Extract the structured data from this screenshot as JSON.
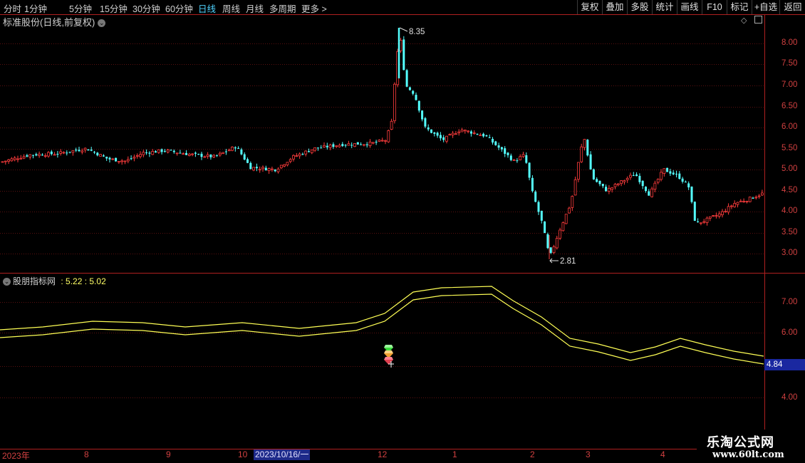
{
  "toolbar": {
    "timeframes": [
      "分时",
      "1分钟",
      "5分钟",
      "15分钟",
      "30分钟",
      "60分钟",
      "日线",
      "周线",
      "月线",
      "多周期",
      "更多 >"
    ],
    "active": "日线",
    "buttons": [
      "复权",
      "叠加",
      "多股",
      "统计",
      "画线",
      "F10",
      "标记",
      "+自选",
      "返回"
    ]
  },
  "main_chart": {
    "title": "标准股份(日线,前复权)",
    "price_axis": [
      "8.00",
      "7.50",
      "7.00",
      "6.50",
      "6.00",
      "5.50",
      "5.00",
      "4.50",
      "4.00",
      "3.50",
      "3.00"
    ],
    "high_label": "8.35",
    "low_label": "2.81"
  },
  "indicator": {
    "title": "股朋指标网",
    "values": ": 5.22 : 5.02",
    "axis": [
      "7.00",
      "6.00",
      "4.00"
    ],
    "current_tag": "4.84"
  },
  "date_axis": {
    "labels": [
      "2023年",
      "8",
      "9",
      "10",
      "2023/10/16/一",
      "12",
      "1",
      "2",
      "3",
      "4"
    ]
  },
  "watermark": {
    "name": "乐淘公式网",
    "url": "www.60lt.com"
  },
  "colors": {
    "up": "#ff3c3c",
    "down": "#54ffff",
    "axis": "#c02020",
    "band": "#ffff55"
  },
  "icons": [
    "chevron-down-icon",
    "diamond-icon",
    "window-icon"
  ]
}
